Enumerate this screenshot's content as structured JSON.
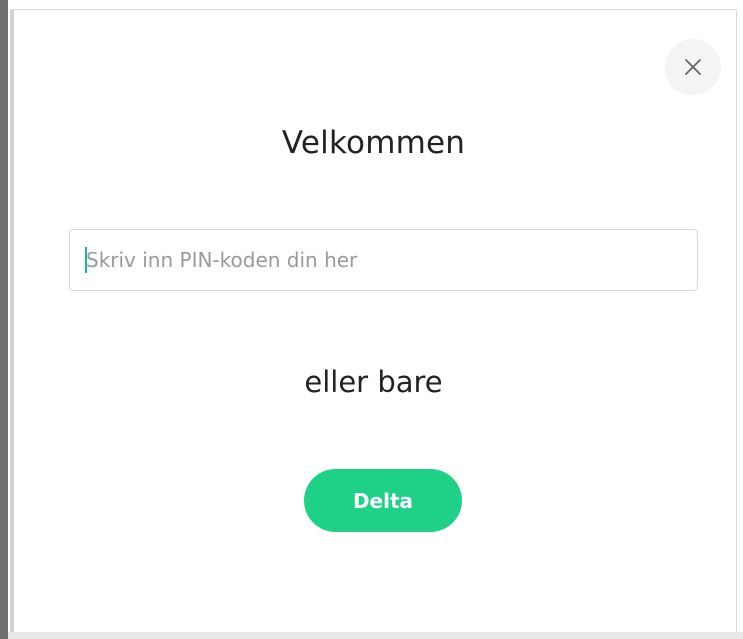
{
  "dialog": {
    "close_icon": "close-icon",
    "title": "Velkommen",
    "pin_input": {
      "value": "",
      "placeholder": "Skriv inn PIN-koden din her"
    },
    "or_label": "eller bare",
    "join_button_label": "Delta"
  },
  "colors": {
    "accent": "#1fd187",
    "caret": "#14b89a",
    "text": "#232323"
  }
}
